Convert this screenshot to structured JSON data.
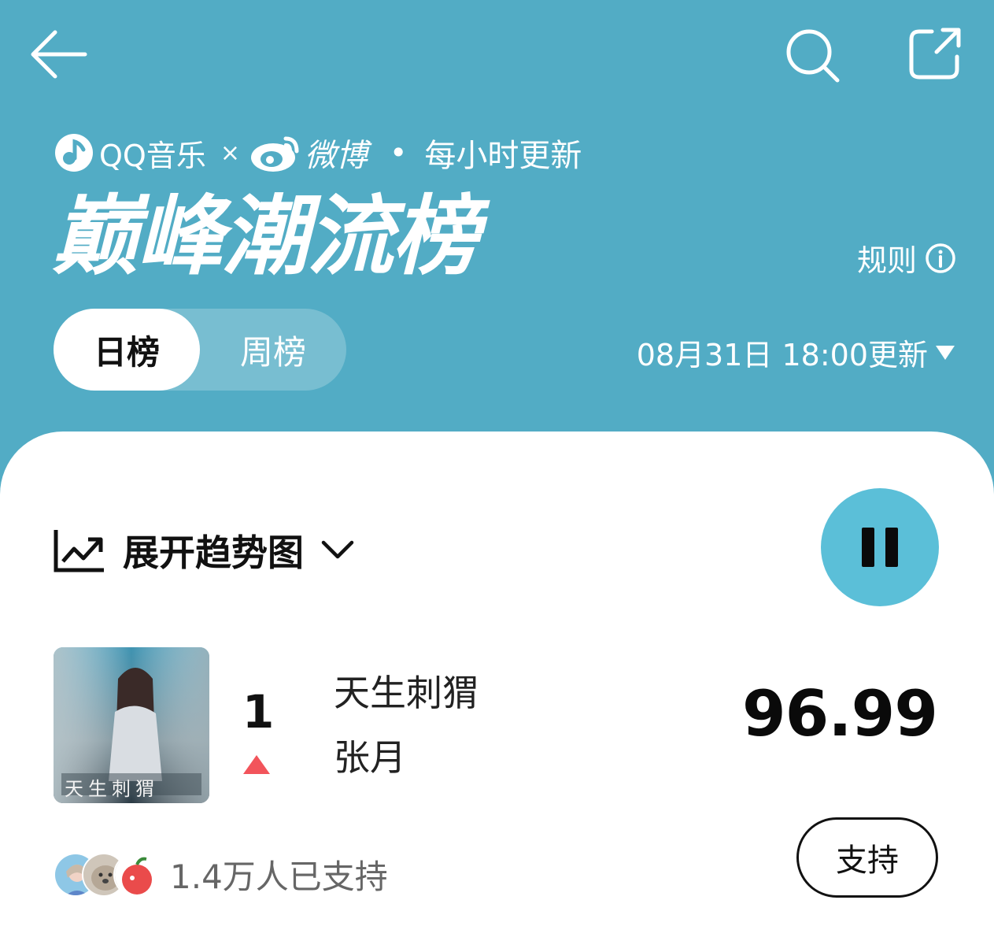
{
  "header": {
    "brand_qq": "QQ音乐",
    "brand_x": "×",
    "brand_weibo": "微博",
    "brand_dot": "•",
    "brand_update": "每小时更新",
    "title": "巅峰潮流榜",
    "rules_label": "规则",
    "tabs": [
      {
        "label": "日榜",
        "active": true
      },
      {
        "label": "周榜",
        "active": false
      }
    ],
    "update_time": "08月31日 18:00更新"
  },
  "controls": {
    "trend_label": "展开趋势图"
  },
  "song": {
    "rank": "1",
    "rank_change": "up",
    "title": "天生刺猬",
    "artist": "张月",
    "score": "96.99",
    "cover_text": "天生刺猬"
  },
  "support": {
    "count_text": "1.4万人已支持",
    "button_label": "支持"
  },
  "colors": {
    "header_bg": "#52acc5",
    "play_button": "#5bbfd8",
    "rank_up": "#f2545b"
  }
}
